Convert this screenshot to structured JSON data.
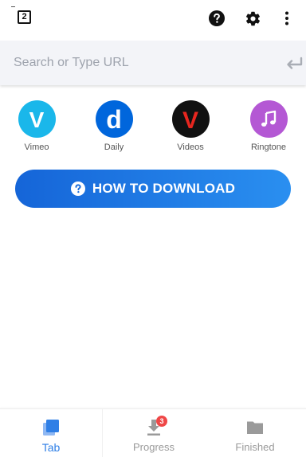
{
  "toolbar": {
    "tab_count": "2",
    "icons": [
      "help-icon",
      "gear-icon",
      "more-vert-icon"
    ]
  },
  "search": {
    "placeholder": "Search or Type URL",
    "value": ""
  },
  "sites": [
    {
      "label": "Vimeo",
      "glyph": "V",
      "color": "#1ab7ea"
    },
    {
      "label": "Daily",
      "glyph": "d",
      "color": "#0066dc"
    },
    {
      "label": "Videos",
      "glyph": "V",
      "color": "#e8261f"
    },
    {
      "label": "Ringtone",
      "glyph": "music-note",
      "color": "#b458d4"
    }
  ],
  "howto": {
    "label": "HOW TO DOWNLOAD",
    "color_start": "#1565d8",
    "color_end": "#2a8ff0"
  },
  "bottom_nav": {
    "items": [
      {
        "label": "Tab",
        "icon": "tabs-icon",
        "active": true
      },
      {
        "label": "Progress",
        "icon": "download-icon",
        "badge": "3"
      },
      {
        "label": "Finished",
        "icon": "folder-icon"
      }
    ],
    "active_color": "#2f7fe6"
  }
}
